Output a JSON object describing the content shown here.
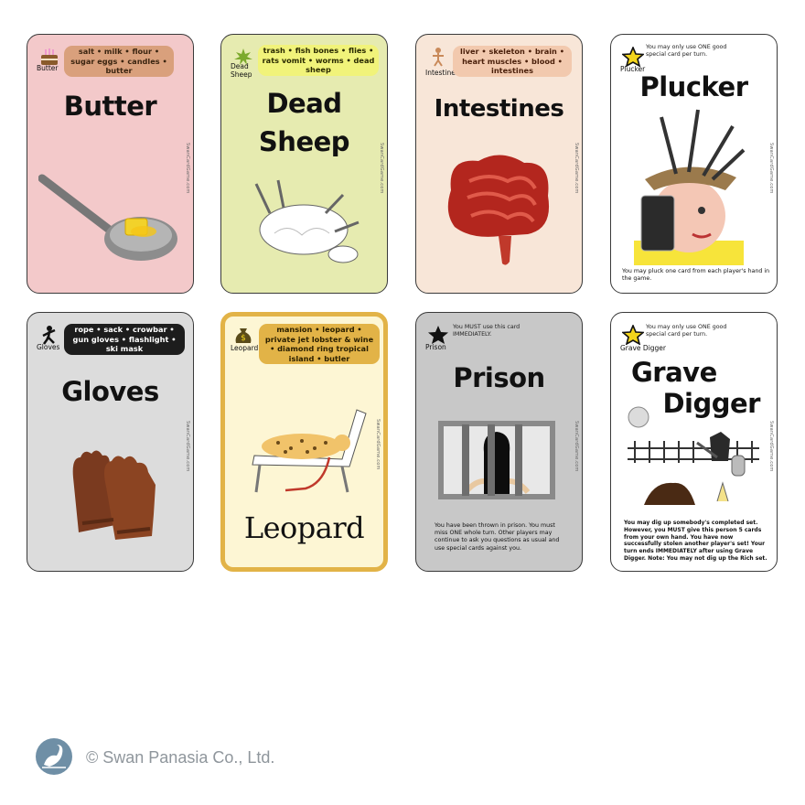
{
  "cards": [
    {
      "tag": "Butter",
      "title": "Butter",
      "items": "salt • milk • flour • sugar eggs • candles • butter",
      "side": "SwanCardGame.com"
    },
    {
      "tag": "Dead Sheep",
      "title_line1": "Dead",
      "title_line2": "Sheep",
      "items": "trash • fish bones • flies • rats vomit • worms • dead sheep",
      "side": "SwanCardGame.com"
    },
    {
      "tag": "Intestines",
      "title": "Intestines",
      "items": "liver • skeleton • brain • heart muscles • blood • intestines",
      "side": "SwanCardGame.com"
    },
    {
      "tag": "Plucker",
      "title": "Plucker",
      "note": "You may only use ONE good special card per turn.",
      "desc": "You may pluck one card from each player's hand in the game.",
      "side": "SwanCardGame.com"
    },
    {
      "tag": "Gloves",
      "title": "Gloves",
      "items": "rope • sack • crowbar • gun gloves • flashlight • ski mask",
      "side": "SwanCardGame.com"
    },
    {
      "tag": "Leopard",
      "title": "Leopard",
      "items": "mansion • leopard • private jet lobster & wine • diamond ring tropical island • butler",
      "side": "SwanCardGame.com"
    },
    {
      "tag": "Prison",
      "title": "Prison",
      "note": "You MUST use this card IMMEDIATELY.",
      "desc": "You have been thrown in prison. You must miss ONE whole turn. Other players may continue to ask you questions as usual and use special cards against you.",
      "side": "SwanCardGame.com"
    },
    {
      "tag": "Grave Digger",
      "title_line1": "Grave",
      "title_line2": "Digger",
      "note": "You may only use ONE good special card per turn.",
      "desc": "You may dig up somebody's completed set. However, you MUST give this person 5 cards from your own hand. You have now successfully stolen another player's set! Your turn ends IMMEDIATELY after using Grave Digger. Note: You may not dig up the Rich set.",
      "side": "SwanCardGame.com"
    }
  ],
  "footer": {
    "logo_text": "SWAN PANASIA",
    "copyright": "© Swan Panasia Co., Ltd."
  },
  "colors": {
    "pink": "#f3c9ca",
    "lime": "#e6ebb0",
    "peach": "#f8e6d8",
    "grey": "#dcdcdc",
    "cream": "#fdf6d4",
    "gold": "#e2b347",
    "slate": "#c8c8c8"
  }
}
